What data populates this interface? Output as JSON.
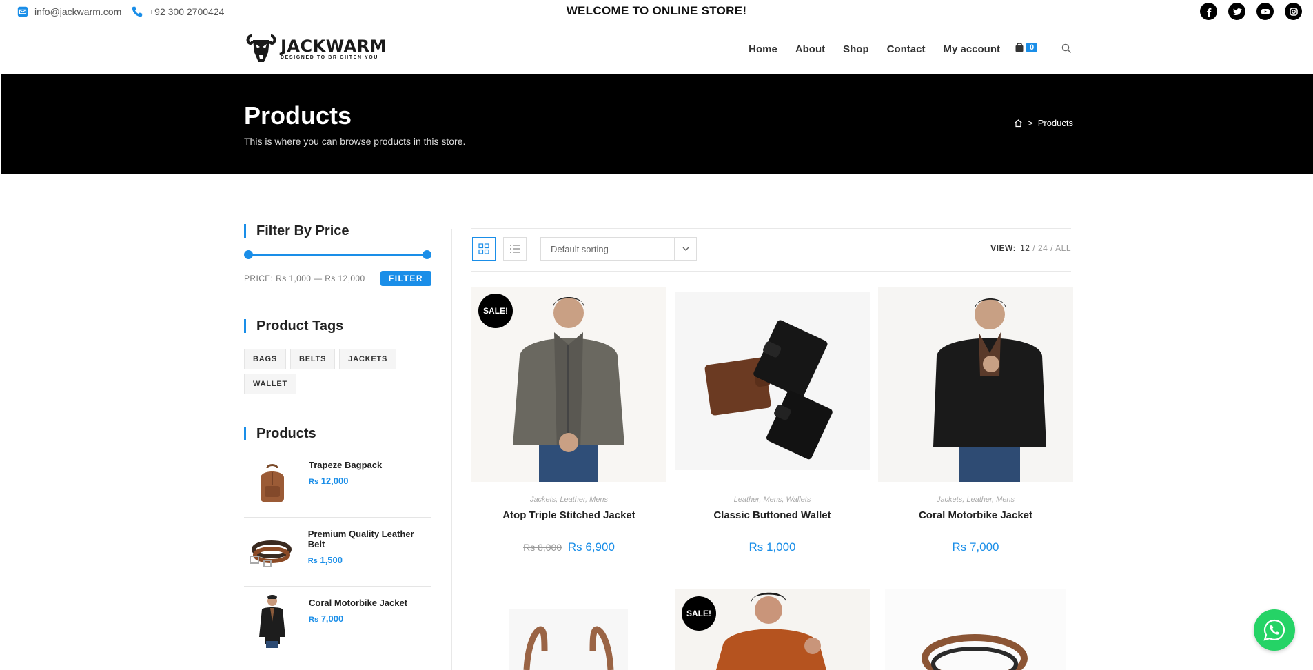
{
  "topbar": {
    "email": "info@jackwarm.com",
    "phone": "+92 300 2700424",
    "welcome": "WELCOME TO ONLINE STORE!",
    "social": [
      "facebook-icon",
      "twitter-icon",
      "youtube-icon",
      "instagram-icon"
    ]
  },
  "header": {
    "logo_name": "JACKWARM",
    "logo_tagline": "DESIGNED TO BRIGHTEN YOU",
    "nav": [
      "Home",
      "About",
      "Shop",
      "Contact",
      "My account"
    ],
    "cart_count": "0"
  },
  "hero": {
    "title": "Products",
    "subtitle": "This is where you can browse products in this store.",
    "breadcrumb_sep": ">",
    "breadcrumb_current": "Products"
  },
  "sidebar": {
    "filter_title": "Filter By Price",
    "price_min_fraction": 0,
    "price_max_fraction": 1,
    "price_label": "PRICE: Rs 1,000 — Rs 12,000",
    "filter_button": "FILTER",
    "tags_title": "Product Tags",
    "tags": [
      "BAGS",
      "BELTS",
      "JACKETS",
      "WALLET"
    ],
    "products_title": "Products",
    "products": [
      {
        "name": "Trapeze Bagpack",
        "currency": "Rs",
        "price": "12,000"
      },
      {
        "name": "Premium Quality Leather Belt",
        "currency": "Rs",
        "price": "1,500"
      },
      {
        "name": "Coral Motorbike Jacket",
        "currency": "Rs",
        "price": "7,000"
      }
    ]
  },
  "toolbar": {
    "sorting": "Default sorting",
    "view_label": "VIEW:",
    "view_12": "12",
    "view_rest": " / 24 / ALL"
  },
  "products": [
    {
      "sale": "SALE!",
      "cats": "Jackets, Leather, Mens",
      "name": "Atop Triple Stitched Jacket",
      "old_price": "Rs 8,000",
      "price": "Rs 6,900"
    },
    {
      "sale": "",
      "cats": "Leather, Mens, Wallets",
      "name": "Classic Buttoned Wallet",
      "old_price": "",
      "price": "Rs 1,000"
    },
    {
      "sale": "",
      "cats": "Jackets, Leather, Mens",
      "name": "Coral Motorbike Jacket",
      "old_price": "",
      "price": "Rs 7,000"
    },
    {
      "sale": "",
      "cats": "",
      "name": "",
      "old_price": "",
      "price": ""
    },
    {
      "sale": "SALE!",
      "cats": "",
      "name": "",
      "old_price": "",
      "price": ""
    },
    {
      "sale": "",
      "cats": "",
      "name": "",
      "old_price": "",
      "price": ""
    }
  ],
  "colors": {
    "accent": "#1a8ee8",
    "hero_bg": "#000000",
    "whatsapp": "#25d366"
  }
}
